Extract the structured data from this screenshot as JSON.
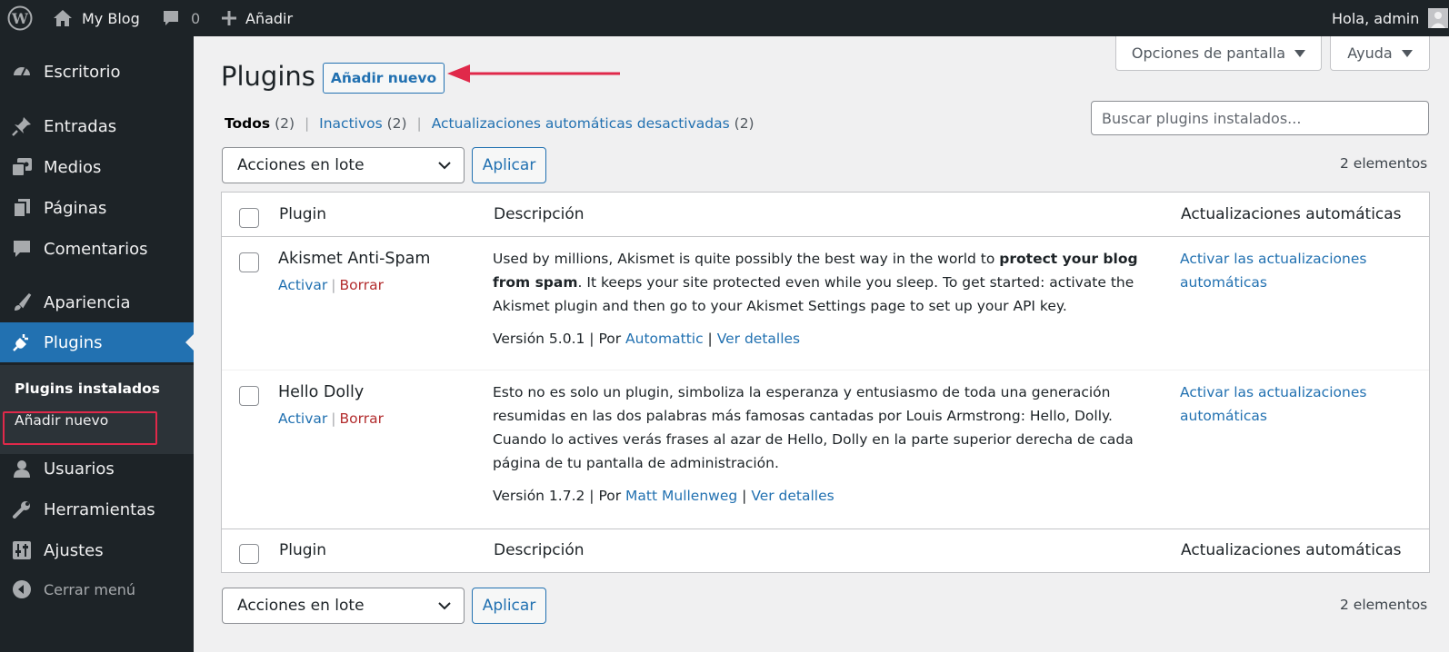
{
  "adminbar": {
    "site_name": "My Blog",
    "comments_count": "0",
    "add_label": "Añadir",
    "greeting": "Hola, admin"
  },
  "sidebar": {
    "items": [
      {
        "label": "Escritorio",
        "icon": "dashboard-icon"
      },
      {
        "label": "Entradas",
        "icon": "pin-icon"
      },
      {
        "label": "Medios",
        "icon": "media-icon"
      },
      {
        "label": "Páginas",
        "icon": "pages-icon"
      },
      {
        "label": "Comentarios",
        "icon": "comment-icon"
      },
      {
        "label": "Apariencia",
        "icon": "brush-icon"
      },
      {
        "label": "Plugins",
        "icon": "plug-icon"
      },
      {
        "label": "Usuarios",
        "icon": "user-icon"
      },
      {
        "label": "Herramientas",
        "icon": "wrench-icon"
      },
      {
        "label": "Ajustes",
        "icon": "settings-icon"
      }
    ],
    "submenu": {
      "installed": "Plugins instalados",
      "add_new": "Añadir nuevo"
    },
    "collapse_label": "Cerrar menú"
  },
  "screen_options": "Opciones de pantalla",
  "help": "Ayuda",
  "page": {
    "title": "Plugins",
    "add_new_button": "Añadir nuevo"
  },
  "filters": {
    "all": "Todos",
    "all_count": "(2)",
    "inactive": "Inactivos",
    "inactive_count": "(2)",
    "auto_disabled": "Actualizaciones automáticas desactivadas",
    "auto_disabled_count": "(2)"
  },
  "search": {
    "placeholder": "Buscar plugins instalados..."
  },
  "bulk": {
    "select_value": "Acciones en lote",
    "apply": "Aplicar",
    "count": "2 elementos"
  },
  "table": {
    "headers": {
      "plugin": "Plugin",
      "description": "Descripción",
      "auto_updates": "Actualizaciones automáticas"
    },
    "rows": [
      {
        "name": "Akismet Anti-Spam",
        "activate": "Activar",
        "delete": "Borrar",
        "desc_1": "Used by millions, Akismet is quite possibly the best way in the world to ",
        "desc_bold_1": "protect your blog",
        "desc_bold_2": "from spam",
        "desc_2": ". It keeps your site protected even while you sleep. To get started: activate the",
        "desc_3": "Akismet plugin and then go to your Akismet Settings page to set up your API key.",
        "version": "Versión 5.0.1",
        "by": "Por",
        "author": "Automattic",
        "details": "Ver detalles",
        "auto_1": "Activar las actualizaciones",
        "auto_2": "automáticas"
      },
      {
        "name": "Hello Dolly",
        "activate": "Activar",
        "delete": "Borrar",
        "desc_1": "Esto no es solo un plugin, simboliza la esperanza y entusiasmo de toda una generación",
        "desc_2": "resumidas en las dos palabras más famosas cantadas por Louis Armstrong: Hello, Dolly.",
        "desc_3": "Cuando lo actives verás frases al azar de Hello, Dolly en la parte superior derecha de cada",
        "desc_4": "página de tu pantalla de administración.",
        "version": "Versión 1.7.2",
        "by": "Por",
        "author": "Matt Mullenweg",
        "details": "Ver detalles",
        "auto_1": "Activar las actualizaciones",
        "auto_2": "automáticas"
      }
    ]
  },
  "colors": {
    "admin_dark": "#1d2327",
    "accent_blue": "#2271b1",
    "highlight_red": "#e0294a",
    "delete_red": "#b32d2e"
  }
}
